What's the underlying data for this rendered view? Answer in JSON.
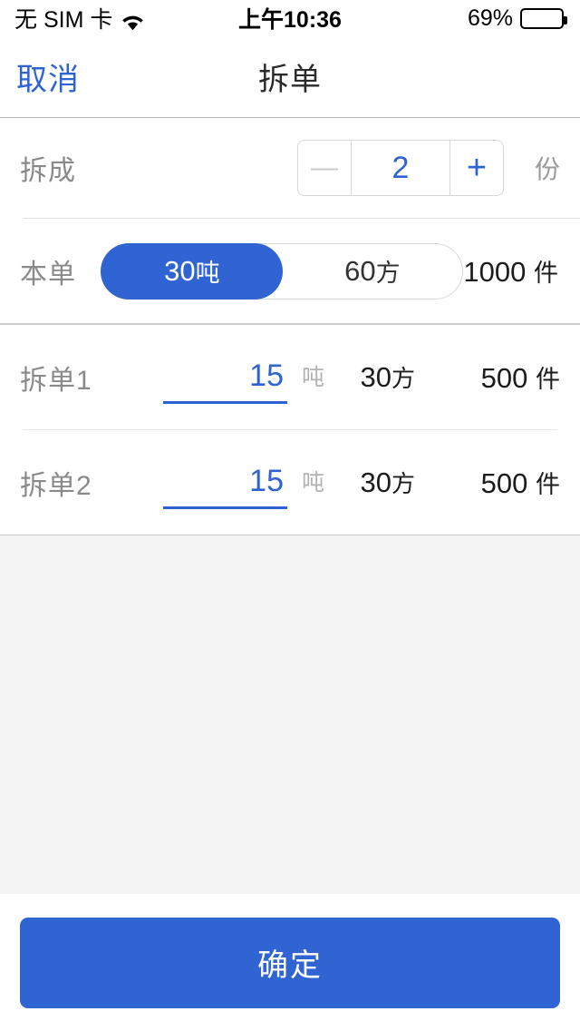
{
  "status_bar": {
    "carrier": "无 SIM 卡",
    "wifi_icon": "wifi-icon",
    "time": "上午10:36",
    "battery_percent": "69%",
    "battery_level": 69
  },
  "nav_bar": {
    "cancel_label": "取消",
    "title": "拆单"
  },
  "count_row": {
    "label": "拆成",
    "minus_label": "—",
    "value": "2",
    "plus_label": "+",
    "unit": "份"
  },
  "main_row": {
    "label": "本单",
    "segments": [
      {
        "number": "30",
        "unit": "吨",
        "selected": true
      },
      {
        "number": "60",
        "unit": "方",
        "selected": false
      }
    ],
    "quantity": "1000",
    "quantity_unit": "件"
  },
  "split_rows": [
    {
      "label": "拆单1",
      "weight_value": "15",
      "weight_unit": "吨",
      "volume_value": "30",
      "volume_unit": "方",
      "quantity_value": "500",
      "quantity_unit": "件"
    },
    {
      "label": "拆单2",
      "weight_value": "15",
      "weight_unit": "吨",
      "volume_value": "30",
      "volume_unit": "方",
      "quantity_value": "500",
      "quantity_unit": "件"
    }
  ],
  "footer": {
    "confirm_label": "确定"
  },
  "colors": {
    "accent_blue": "#3064d2",
    "link_blue": "#2f63d2",
    "label_gray": "#8a8a8a",
    "page_gray": "#f4f4f4"
  }
}
